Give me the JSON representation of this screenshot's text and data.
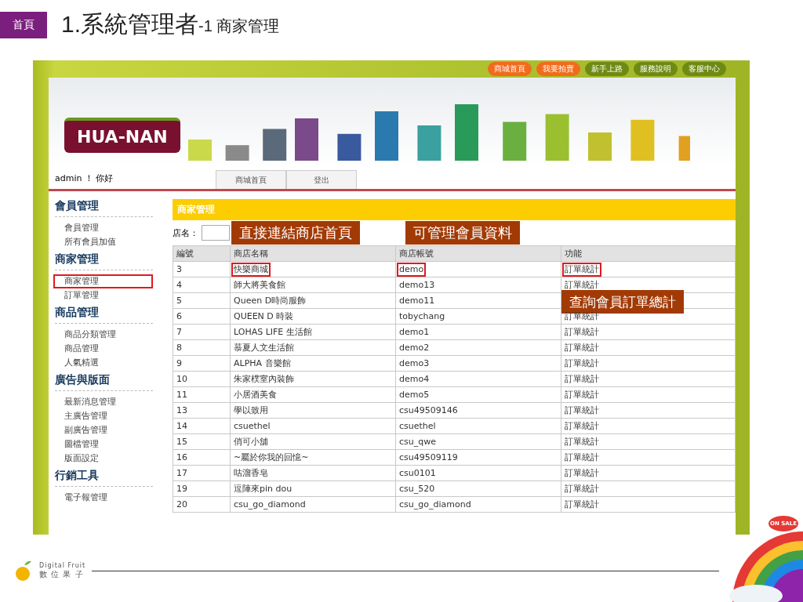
{
  "slide": {
    "tag": "首頁",
    "title": "1.系統管理者",
    "subtitle": "-1 商家管理"
  },
  "top_nav": [
    {
      "label": "商城首頁",
      "kind": "orange"
    },
    {
      "label": "我要拍賣",
      "kind": "orange"
    },
    {
      "label": "新手上路",
      "kind": "green"
    },
    {
      "label": "服務說明",
      "kind": "green"
    },
    {
      "label": "客服中心",
      "kind": "green"
    }
  ],
  "banner": {
    "logo": "HUA-NAN"
  },
  "user_bar": {
    "greeting": "admin ！ 你好",
    "tabs": [
      "商城首頁",
      "登出"
    ]
  },
  "sidebar": [
    {
      "heading": "會員管理",
      "items": [
        {
          "label": "會員管理",
          "selected": false
        },
        {
          "label": "所有會員加值",
          "selected": false
        }
      ]
    },
    {
      "heading": "商家管理",
      "items": [
        {
          "label": "商家管理",
          "selected": true
        },
        {
          "label": "訂單管理",
          "selected": false
        }
      ]
    },
    {
      "heading": "商品管理",
      "items": [
        {
          "label": "商品分類管理",
          "selected": false
        },
        {
          "label": "商品管理",
          "selected": false
        },
        {
          "label": "人氣精選",
          "selected": false
        }
      ]
    },
    {
      "heading": "廣告與版面",
      "items": [
        {
          "label": "最新消息管理",
          "selected": false
        },
        {
          "label": "主廣告管理",
          "selected": false
        },
        {
          "label": "副廣告管理",
          "selected": false
        },
        {
          "label": "圖檔管理",
          "selected": false
        },
        {
          "label": "版面設定",
          "selected": false
        }
      ]
    },
    {
      "heading": "行銷工具",
      "items": [
        {
          "label": "電子報管理",
          "selected": false
        }
      ]
    }
  ],
  "panel": {
    "title": "商家管理",
    "search_label": "店名：",
    "callouts": [
      "直接連結商店首頁",
      "可管理會員資料",
      "查詢會員訂單總計"
    ]
  },
  "table": {
    "columns": [
      "編號",
      "商店名稱",
      "商店帳號",
      "功能"
    ],
    "rows": [
      {
        "id": "3",
        "name": "快樂商城",
        "account": "demo",
        "function": "訂單統計",
        "highlighted": true
      },
      {
        "id": "4",
        "name": "師大將美食館",
        "account": "demo13",
        "function": "訂單統計",
        "highlighted": false
      },
      {
        "id": "5",
        "name": "Queen D時尚服飾",
        "account": "demo11",
        "highlighted": false
      },
      {
        "id": "6",
        "name": "QUEEN D 時裝",
        "account": "tobychang",
        "function": "訂單統計",
        "highlighted": false
      },
      {
        "id": "7",
        "name": "LOHAS LIFE 生活館",
        "account": "demo1",
        "function": "訂單統計",
        "highlighted": false
      },
      {
        "id": "8",
        "name": "慕夏人文生活館",
        "account": "demo2",
        "function": "訂單統計",
        "highlighted": false
      },
      {
        "id": "9",
        "name": "ALPHA 音樂館",
        "account": "demo3",
        "function": "訂單統計",
        "highlighted": false
      },
      {
        "id": "10",
        "name": "朱家樸室內裝飾",
        "account": "demo4",
        "function": "訂單統計",
        "highlighted": false
      },
      {
        "id": "11",
        "name": "小居酒美食",
        "account": "demo5",
        "function": "訂單統計",
        "highlighted": false
      },
      {
        "id": "13",
        "name": "學以致用",
        "account": "csu49509146",
        "function": "訂單統計",
        "highlighted": false
      },
      {
        "id": "14",
        "name": "csuethel",
        "account": "csuethel",
        "function": "訂單統計",
        "highlighted": false
      },
      {
        "id": "15",
        "name": "俏可小舖",
        "account": "csu_qwe",
        "function": "訂單統計",
        "highlighted": false
      },
      {
        "id": "16",
        "name": "~屬於你我的回憶~",
        "account": "csu49509119",
        "function": "訂單統計",
        "highlighted": false
      },
      {
        "id": "17",
        "name": "咕溜香皂",
        "account": "csu0101",
        "function": "訂單統計",
        "highlighted": false
      },
      {
        "id": "19",
        "name": "逗陣來pin dou",
        "account": "csu_520",
        "function": "訂單統計",
        "highlighted": false
      },
      {
        "id": "20",
        "name": "csu_go_diamond",
        "account": "csu_go_diamond",
        "function": "訂單統計",
        "highlighted": false
      }
    ]
  },
  "footer": {
    "brand": "Digital Fruit",
    "brand_sub": "數 位 果 子",
    "sticker": "ON SALE"
  }
}
